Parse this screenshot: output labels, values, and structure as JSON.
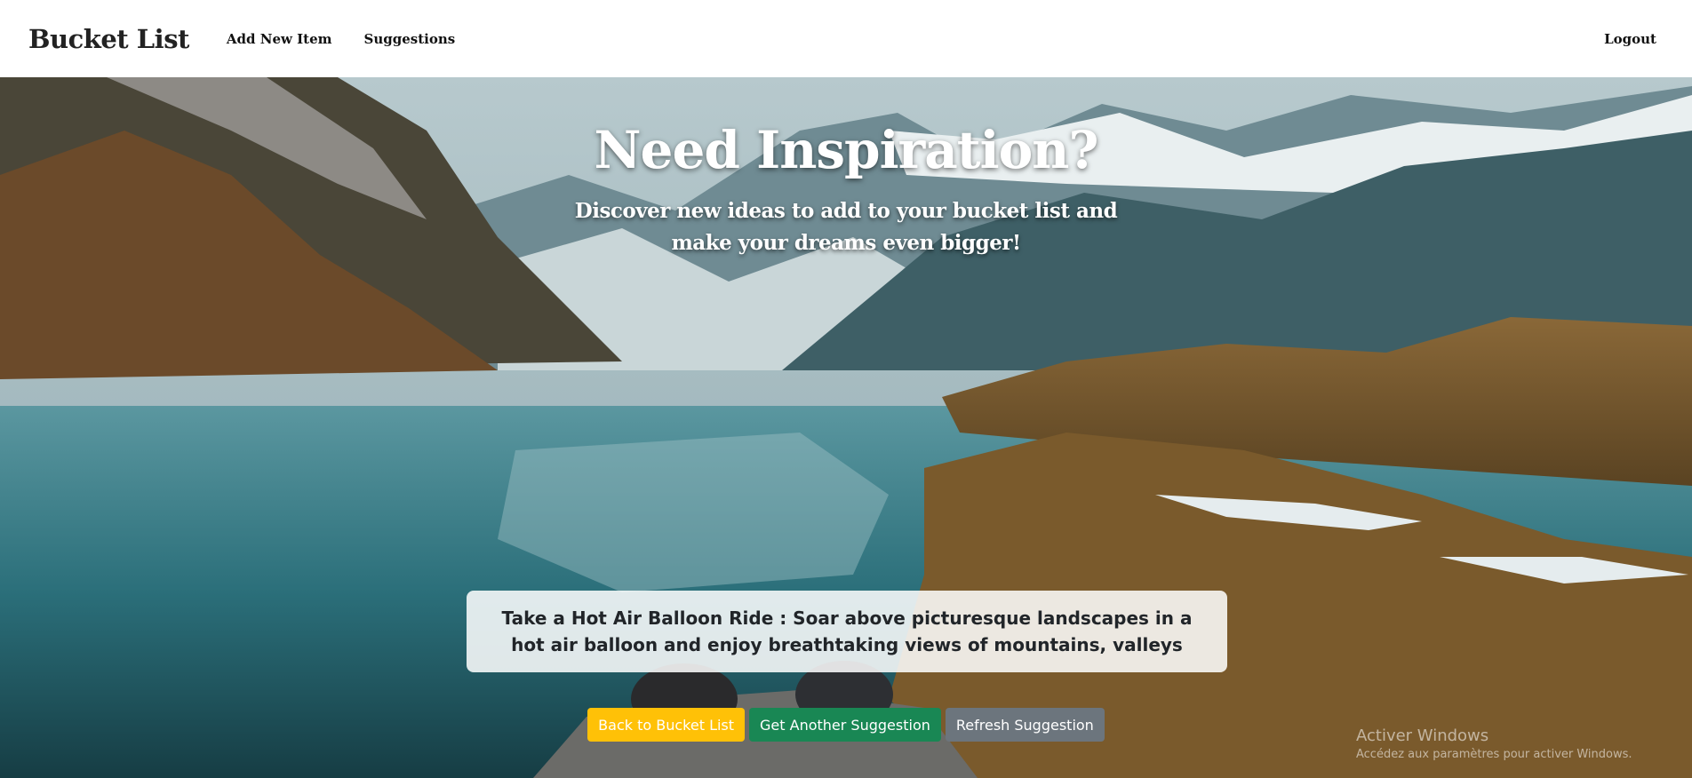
{
  "navbar": {
    "brand": "Bucket List",
    "links": [
      "Add New Item",
      "Suggestions"
    ],
    "logout": "Logout"
  },
  "hero": {
    "title": "Need Inspiration?",
    "subtitle": "Discover new ideas to add to your bucket list and make your dreams even bigger!",
    "suggestion": "Take a Hot Air Balloon Ride : Soar above picturesque landscapes in a hot air balloon and enjoy breathtaking views of mountains, valleys"
  },
  "buttons": {
    "back": "Back to Bucket List",
    "another": "Get Another Suggestion",
    "refresh": "Refresh Suggestion"
  },
  "watermark": {
    "title": "Activer Windows",
    "subtitle": "Accédez aux paramètres pour activer Windows."
  },
  "colors": {
    "warning": "#ffc107",
    "success": "#198754",
    "secondary": "#6c757d"
  }
}
